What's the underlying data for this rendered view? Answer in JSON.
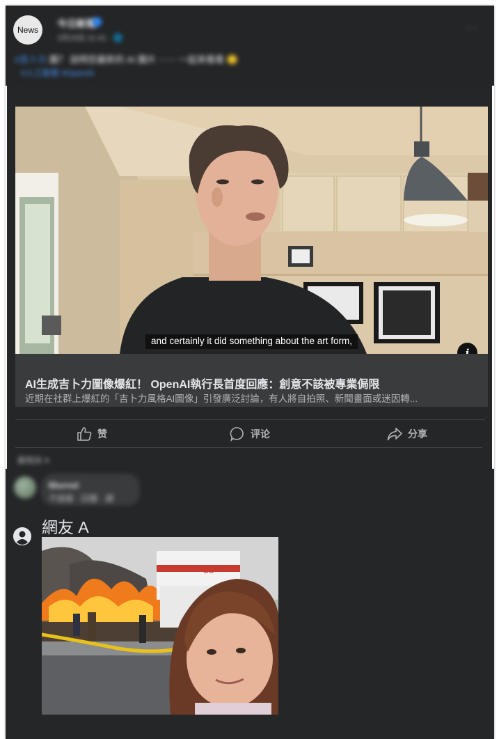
{
  "post": {
    "author": "今日新聞",
    "time": "3月29日 21:41 · 🌐",
    "avatar_label": "News",
    "more": "···",
    "text_highlight": "#吉卜力",
    "text_body": "圖？ 說明您最新的 AI 圖片 ⋯⋯ 一起來看看 🙂",
    "text_link": "#人工智慧 #OpenAI"
  },
  "preview": {
    "subtitle": "and certainly it did something about the art form,",
    "info_icon": "i",
    "title": "AI生成吉卜力圖像爆紅！ OpenAI執行長首度回應：創意不該被專業侷限",
    "description": "近期在社群上爆紅的「吉卜力風格AI圖像」引發廣泛討論，有人將自拍照、新聞畫面或迷因轉..."
  },
  "actions": {
    "like": "赞",
    "comment": "评论",
    "share": "分享"
  },
  "comments": {
    "sort_label": "最相关 ▾",
    "first": {
      "name": "Blurred",
      "text": "不錯看 · 回覆 · 讚"
    },
    "second": {
      "name": "網友 A"
    }
  },
  "colors": {
    "panel": "#242526",
    "caption_bg": "#3a3b3c",
    "text_primary": "#e4e6eb",
    "text_secondary": "#b0b3b8",
    "link": "#4599ff"
  },
  "icons": [
    "thumbs-up-icon",
    "comment-icon",
    "share-icon",
    "info-icon",
    "person-icon",
    "verified-icon"
  ]
}
